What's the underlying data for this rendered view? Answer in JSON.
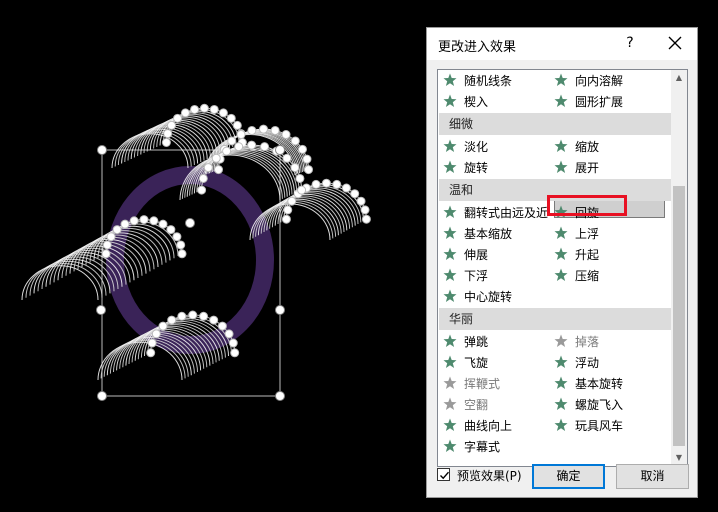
{
  "dialog": {
    "title": "更改进入效果",
    "help": "?",
    "preview_label": "预览效果(P)",
    "preview_checked": true,
    "ok_label": "确定",
    "cancel_label": "取消"
  },
  "colors": {
    "star": "#4e8a6e",
    "star_disabled": "#9a9a9a",
    "highlight": "#e81123"
  },
  "effects": {
    "top_rows": [
      [
        "随机线条",
        "向内溶解"
      ],
      [
        "楔入",
        "圆形扩展"
      ]
    ],
    "subtle_header": "细微",
    "subtle": [
      [
        "淡化",
        "缩放"
      ],
      [
        "旋转",
        "展开"
      ]
    ],
    "moderate_header": "温和",
    "moderate": [
      [
        "翻转式由远及近",
        "回旋"
      ],
      [
        "基本缩放",
        "上浮"
      ],
      [
        "伸展",
        "升起"
      ],
      [
        "下浮",
        "压缩"
      ],
      [
        "中心旋转",
        ""
      ]
    ],
    "exciting_header": "华丽",
    "exciting": [
      [
        "弹跳",
        "掉落"
      ],
      [
        "飞旋",
        "浮动"
      ],
      [
        "挥鞭式",
        "基本旋转"
      ],
      [
        "空翻",
        "螺旋飞入"
      ],
      [
        "曲线向上",
        "玩具风车"
      ],
      [
        "字幕式",
        ""
      ]
    ],
    "selected": "回旋"
  }
}
